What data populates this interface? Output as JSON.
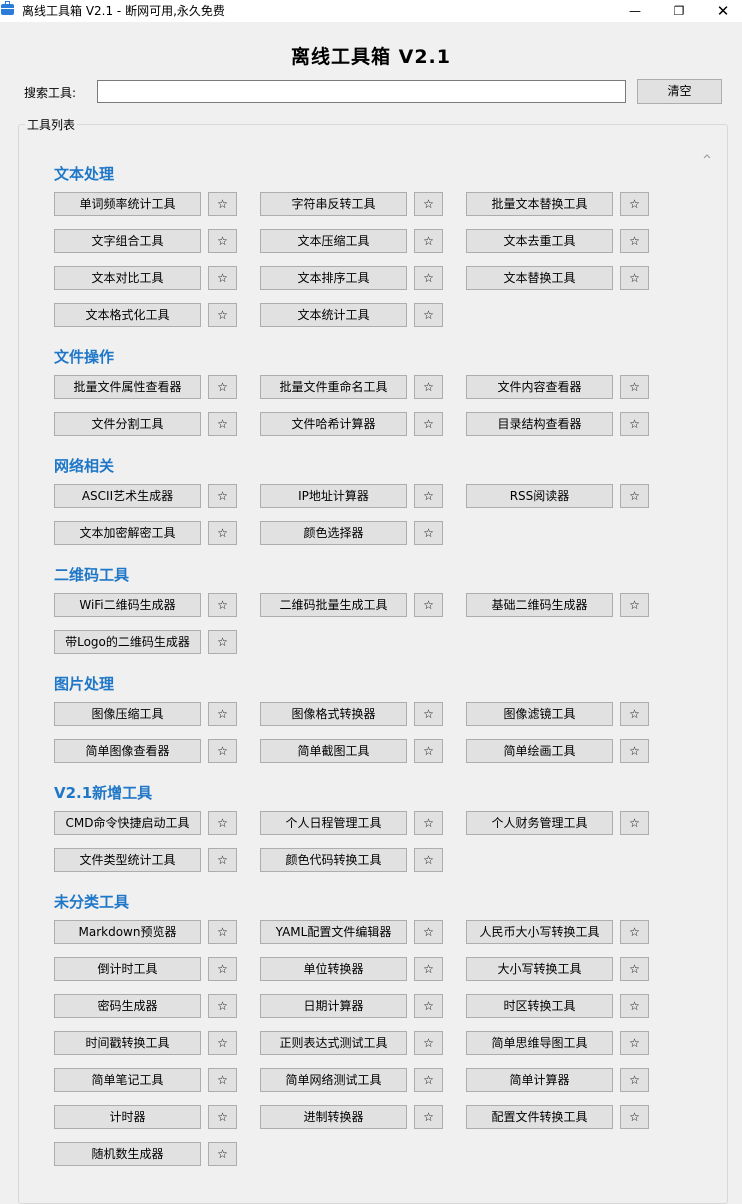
{
  "window": {
    "title": "离线工具箱 V2.1 - 断网可用,永久免费",
    "min_glyph": "—",
    "max_glyph": "❐",
    "close_glyph": "✕"
  },
  "app": {
    "heading": "离线工具箱 V2.1"
  },
  "search": {
    "label": "搜索工具:",
    "value": "",
    "placeholder": "",
    "clear_label": "清空"
  },
  "tool_list": {
    "label": "工具列表"
  },
  "star_glyph": "☆",
  "colors": {
    "section_title": "#1f77c8",
    "button_bg": "#e1e1e1",
    "button_border": "#adadad"
  },
  "sections": [
    {
      "title": "文本处理",
      "tools": [
        "单词频率统计工具",
        "字符串反转工具",
        "批量文本替换工具",
        "文字组合工具",
        "文本压缩工具",
        "文本去重工具",
        "文本对比工具",
        "文本排序工具",
        "文本替换工具",
        "文本格式化工具",
        "文本统计工具"
      ]
    },
    {
      "title": "文件操作",
      "tools": [
        "批量文件属性查看器",
        "批量文件重命名工具",
        "文件内容查看器",
        "文件分割工具",
        "文件哈希计算器",
        "目录结构查看器"
      ]
    },
    {
      "title": "网络相关",
      "tools": [
        "ASCII艺术生成器",
        "IP地址计算器",
        "RSS阅读器",
        "文本加密解密工具",
        "颜色选择器"
      ]
    },
    {
      "title": "二维码工具",
      "tools": [
        "WiFi二维码生成器",
        "二维码批量生成工具",
        "基础二维码生成器",
        "带Logo的二维码生成器"
      ]
    },
    {
      "title": "图片处理",
      "tools": [
        "图像压缩工具",
        "图像格式转换器",
        "图像滤镜工具",
        "简单图像查看器",
        "简单截图工具",
        "简单绘画工具"
      ]
    },
    {
      "title": "V2.1新增工具",
      "tools": [
        "CMD命令快捷启动工具",
        "个人日程管理工具",
        "个人财务管理工具",
        "文件类型统计工具",
        "颜色代码转换工具"
      ]
    },
    {
      "title": "未分类工具",
      "tools": [
        "Markdown预览器",
        "YAML配置文件编辑器",
        "人民币大小写转换工具",
        "倒计时工具",
        "单位转换器",
        "大小写转换工具",
        "密码生成器",
        "日期计算器",
        "时区转换工具",
        "时间戳转换工具",
        "正则表达式测试工具",
        "简单思维导图工具",
        "简单笔记工具",
        "简单网络测试工具",
        "简单计算器",
        "计时器",
        "进制转换器",
        "配置文件转换工具",
        "随机数生成器"
      ]
    }
  ]
}
